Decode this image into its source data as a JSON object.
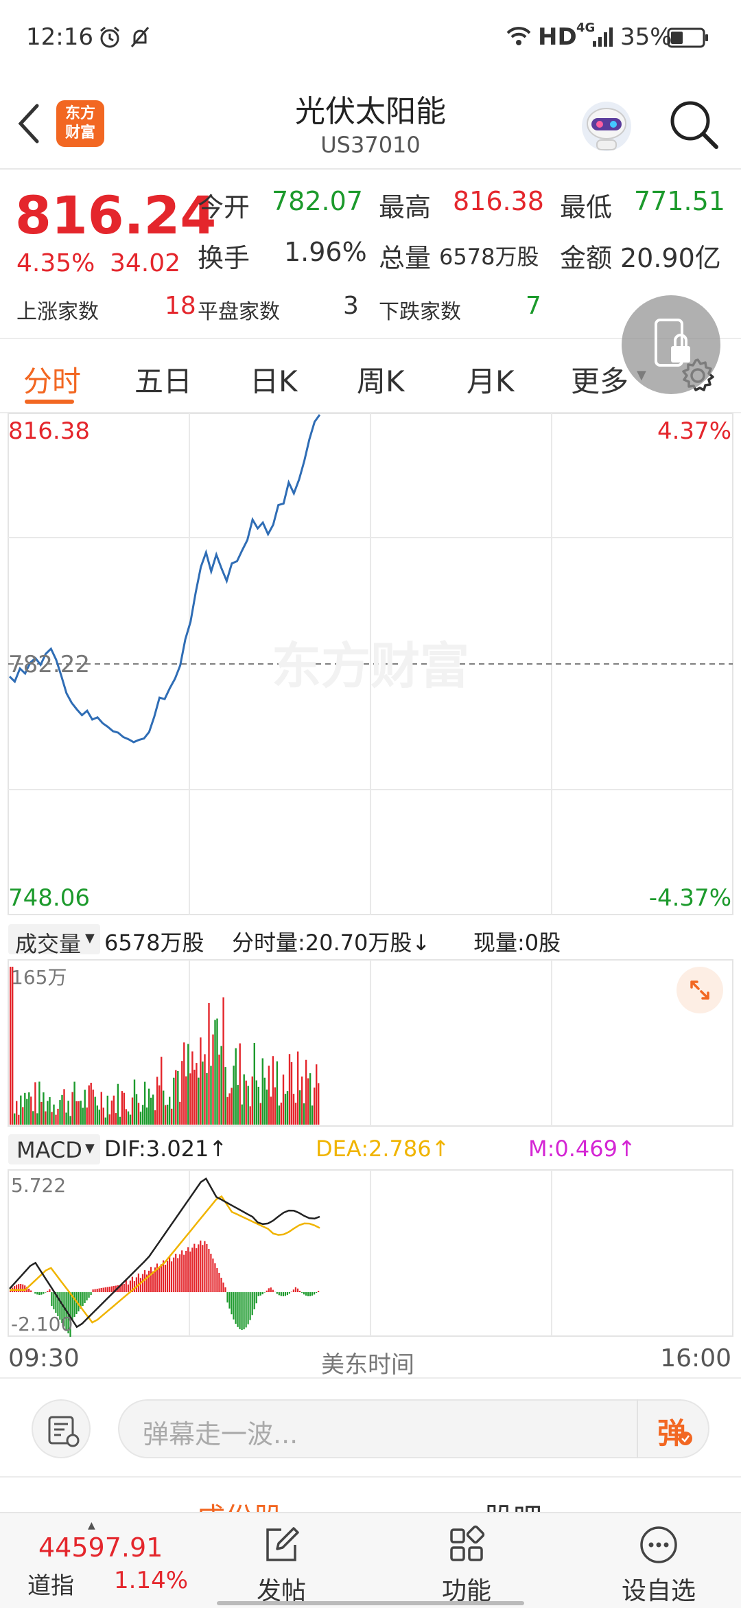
{
  "status_bar": {
    "time": "12:16",
    "network": "HD",
    "network_gen": "4G",
    "battery": "35%"
  },
  "header": {
    "logo_text_line1": "东方",
    "logo_text_line2": "财富",
    "title": "光伏太阳能",
    "code": "US37010"
  },
  "quote": {
    "price": "816.24",
    "change_pct": "4.35%",
    "change_amt": "34.02",
    "open_label": "今开",
    "open": "782.07",
    "high_label": "最高",
    "high": "816.38",
    "low_label": "最低",
    "low": "771.51",
    "turnover_label": "换手",
    "turnover": "1.96%",
    "volume_label": "总量",
    "volume": "6578万股",
    "amount_label": "金额",
    "amount": "20.90亿",
    "up_label": "上涨家数",
    "up_count": "18",
    "flat_label": "平盘家数",
    "flat_count": "3",
    "down_label": "下跌家数",
    "down_count": "7"
  },
  "tabs": [
    "分时",
    "五日",
    "日K",
    "周K",
    "月K",
    "更多"
  ],
  "active_tab": 0,
  "chart_data": [
    {
      "type": "line",
      "title": "",
      "xlabel": "美东时间",
      "x_start": "09:30",
      "x_end": "16:00",
      "ylim": [
        748.06,
        816.38
      ],
      "y_top_label": "816.38",
      "y_bottom_label": "748.06",
      "y_ref_label": "782.22",
      "pct_top_label": "4.37%",
      "pct_bottom_label": "-4.37%",
      "watermark": "东方财富",
      "series": [
        {
          "values": [
            780.5,
            779.8,
            781.6,
            780.9,
            782.4,
            783.0,
            782.1,
            783.6,
            784.3,
            782.8,
            780.6,
            778.2,
            776.9,
            776.0,
            775.2,
            775.8,
            774.6,
            774.9,
            774.1,
            773.6,
            773.0,
            772.8,
            772.2,
            771.9,
            771.5,
            771.8,
            772.0,
            772.9,
            775.0,
            777.6,
            777.4,
            778.9,
            780.2,
            782.0,
            785.6,
            788.0,
            792.0,
            795.5,
            797.5,
            794.9,
            797.2,
            795.3,
            793.6,
            796.0,
            796.3,
            797.8,
            799.2,
            802.0,
            800.8,
            801.6,
            800.0,
            801.3,
            804.0,
            804.2,
            807.1,
            805.6,
            807.5,
            810.0,
            813.0,
            815.4,
            816.38
          ]
        }
      ]
    },
    {
      "type": "bar",
      "title": "成交量",
      "ylabel": "165万",
      "ylim": [
        0,
        165
      ],
      "total_label": "6578万股",
      "period_label": "分时量:20.70万股↓",
      "current_label": "现量:0股"
    },
    {
      "type": "line",
      "title": "MACD",
      "ylim": [
        -2.1,
        5.722
      ],
      "y_top_label": "5.722",
      "y_bottom_label": "-2.100",
      "dif_label": "DIF:3.021↑",
      "dea_label": "DEA:2.786↑",
      "m_label": "M:0.469↑"
    }
  ],
  "comment": {
    "placeholder": "弹幕走一波...",
    "danmu_label": "弹"
  },
  "bottom_tabs_partial": [
    "成份股",
    "股吧"
  ],
  "bottom_bar": {
    "index_value": "44597.91",
    "index_name": "道指",
    "index_change": "1.14%",
    "post_label": "发帖",
    "function_label": "功能",
    "watchlist_label": "设自选"
  },
  "colors": {
    "up": "#e4262c",
    "down": "#1c9a2c",
    "accent": "#f26722",
    "line": "#2f6db5",
    "dea": "#f0b400",
    "m": "#d426d4"
  }
}
